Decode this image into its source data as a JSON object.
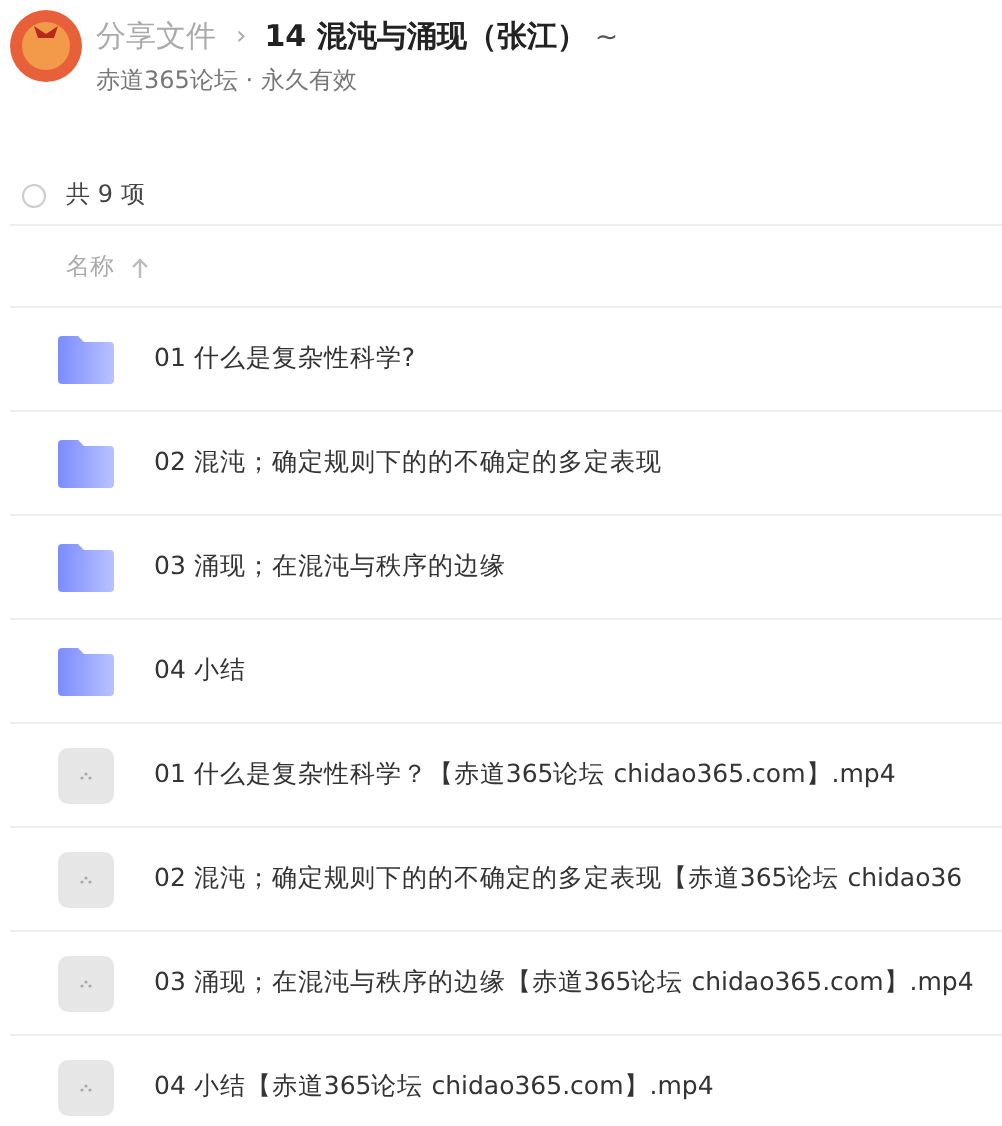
{
  "header": {
    "breadcrumb": "分享文件",
    "separator": "›",
    "title": "14 混沌与涌现（张江）",
    "title_caret": "~",
    "subtitle": "赤道365论坛 · 永久有效"
  },
  "summary": {
    "select_all": {
      "checked": false
    },
    "count": "共 9 项"
  },
  "table": {
    "columns": [
      {
        "label": "名称",
        "sort_ascending": true
      }
    ],
    "rows": [
      {
        "kind": "folder",
        "name": "01 什么是复杂性科学?"
      },
      {
        "kind": "folder",
        "name": "02 混沌；确定规则下的的不确定的多定表现"
      },
      {
        "kind": "folder",
        "name": "03 涌现；在混沌与秩序的边缘"
      },
      {
        "kind": "folder",
        "name": "04 小结"
      },
      {
        "kind": "video",
        "name": "01 什么是复杂性科学？【赤道365论坛 chidao365.com】.mp4"
      },
      {
        "kind": "video",
        "name": "02 混沌；确定规则下的的不确定的多定表现【赤道365论坛 chidao36"
      },
      {
        "kind": "video",
        "name": "03 涌现；在混沌与秩序的边缘【赤道365论坛 chidao365.com】.mp4"
      },
      {
        "kind": "video",
        "name": "04 小结【赤道365论坛 chidao365.com】.mp4"
      }
    ]
  }
}
